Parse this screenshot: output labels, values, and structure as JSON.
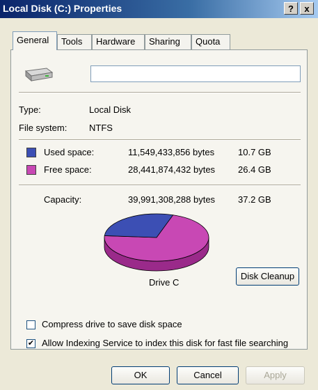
{
  "window": {
    "title": "Local Disk (C:) Properties",
    "help_label": "?",
    "close_label": "x"
  },
  "tabs": [
    "General",
    "Tools",
    "Hardware",
    "Sharing",
    "Quota"
  ],
  "drive": {
    "name_value": "",
    "type_label": "Type:",
    "type_value": "Local Disk",
    "fs_label": "File system:",
    "fs_value": "NTFS"
  },
  "space": {
    "used_label": "Used space:",
    "used_bytes": "11,549,433,856 bytes",
    "used_gb": "10.7 GB",
    "used_color": "#3c4fb4",
    "free_label": "Free space:",
    "free_bytes": "28,441,874,432 bytes",
    "free_gb": "26.4 GB",
    "free_color": "#c848b4",
    "capacity_label": "Capacity:",
    "capacity_bytes": "39,991,308,288 bytes",
    "capacity_gb": "37.2 GB",
    "drive_label": "Drive C",
    "used_fraction": 0.289
  },
  "buttons": {
    "disk_cleanup": "Disk Cleanup",
    "ok": "OK",
    "cancel": "Cancel",
    "apply": "Apply"
  },
  "options": {
    "compress_label": "Compress drive to save disk space",
    "compress_checked": false,
    "index_label": "Allow Indexing Service to index this disk for fast file searching",
    "index_checked": true
  }
}
